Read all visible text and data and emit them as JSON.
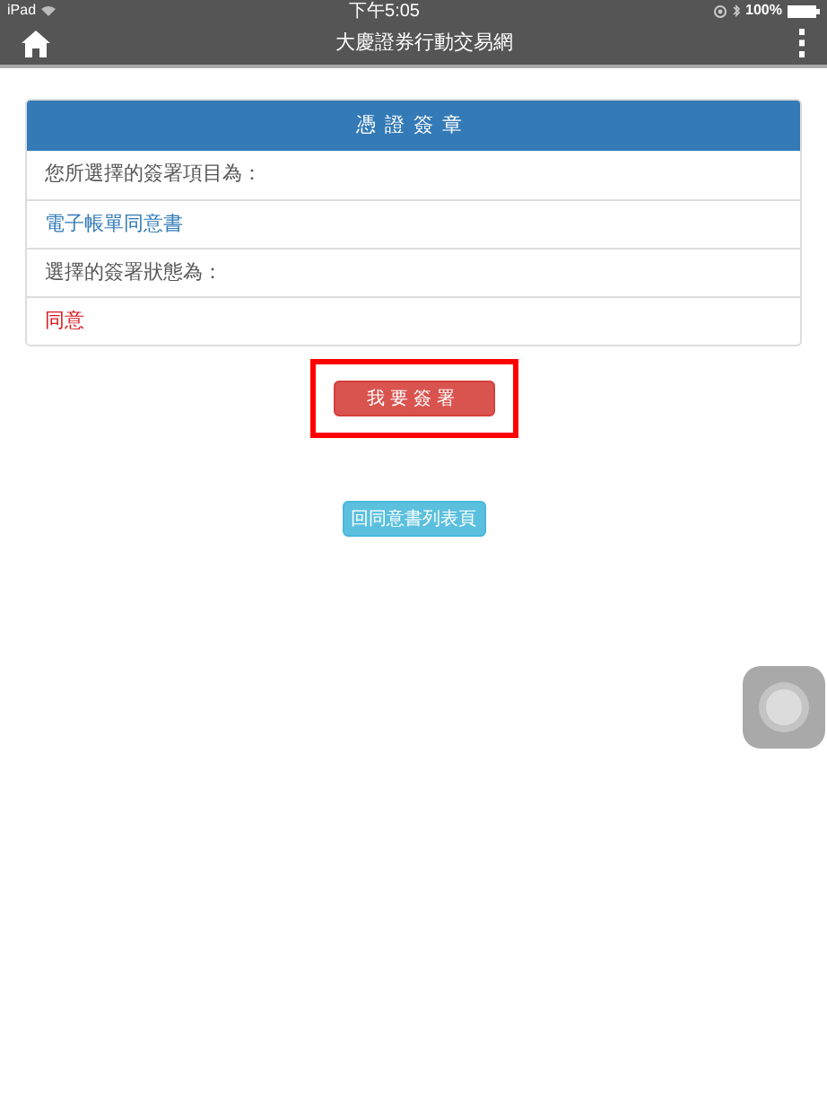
{
  "status_bar": {
    "device": "iPad",
    "time": "下午5:05",
    "battery": "100%"
  },
  "nav_bar": {
    "title": "大慶證券行動交易網"
  },
  "panel": {
    "title": "憑證簽章",
    "rows": [
      {
        "kind": "label",
        "text": "您所選擇的簽署項目為："
      },
      {
        "kind": "value",
        "text": "電子帳單同意書"
      },
      {
        "kind": "label",
        "text": "選擇的簽署狀態為："
      },
      {
        "kind": "status",
        "text": "同意"
      }
    ]
  },
  "buttons": [
    {
      "kind": "danger",
      "label": "我要簽署",
      "highlighted": true
    },
    {
      "kind": "info",
      "label": "回同意書列表頁",
      "highlighted": false
    }
  ]
}
